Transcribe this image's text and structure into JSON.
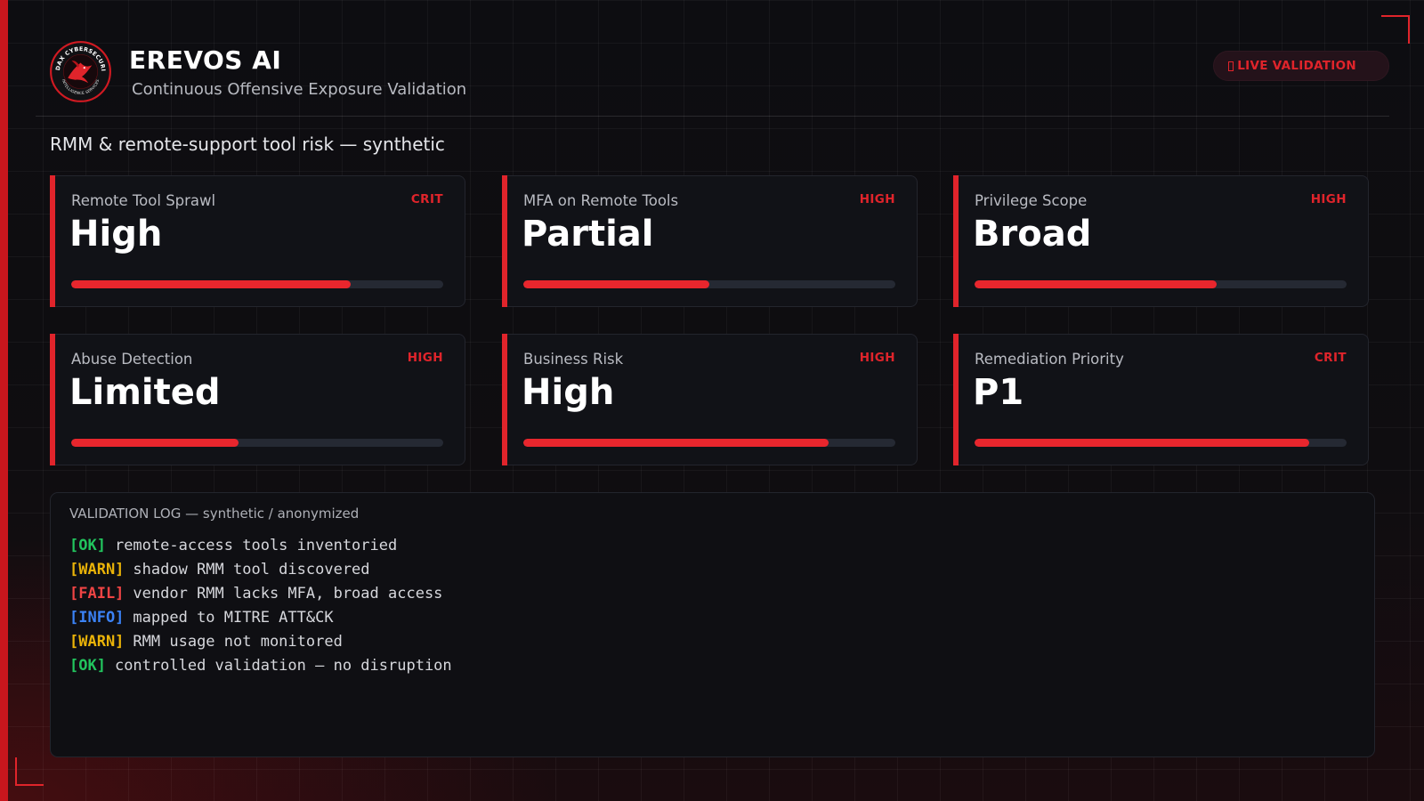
{
  "header": {
    "logo_text_top": "AUDAX CYBERSECURITY",
    "logo_text_bottom": "INTELLIGENCE SERVICES",
    "title": "EREVOS AI",
    "subtitle": "Continuous Offensive Exposure Validation",
    "live_badge": "LIVE VALIDATION"
  },
  "section_title": "RMM & remote-support tool risk — synthetic",
  "accent_color": "#e0242b",
  "cards": [
    {
      "label": "Remote Tool Sprawl",
      "severity": "CRIT",
      "value": "High",
      "level": 0.75
    },
    {
      "label": "MFA on Remote Tools",
      "severity": "HIGH",
      "value": "Partial",
      "level": 0.5
    },
    {
      "label": "Privilege Scope",
      "severity": "HIGH",
      "value": "Broad",
      "level": 0.65
    },
    {
      "label": "Abuse Detection",
      "severity": "HIGH",
      "value": "Limited",
      "level": 0.45
    },
    {
      "label": "Business Risk",
      "severity": "HIGH",
      "value": "High",
      "level": 0.82
    },
    {
      "label": "Remediation Priority",
      "severity": "CRIT",
      "value": "P1",
      "level": 0.9
    }
  ],
  "log": {
    "title": "VALIDATION LOG — synthetic / anonymized",
    "lines": [
      {
        "tag": "[OK]",
        "kind": "ok",
        "text": "remote-access tools inventoried"
      },
      {
        "tag": "[WARN]",
        "kind": "warn",
        "text": "shadow RMM tool discovered"
      },
      {
        "tag": "[FAIL]",
        "kind": "fail",
        "text": "vendor RMM lacks MFA, broad access"
      },
      {
        "tag": "[INFO]",
        "kind": "info",
        "text": "mapped to MITRE ATT&CK"
      },
      {
        "tag": "[WARN]",
        "kind": "warn",
        "text": "RMM usage not monitored"
      },
      {
        "tag": "[OK]",
        "kind": "ok",
        "text": "controlled validation — no disruption"
      }
    ]
  }
}
